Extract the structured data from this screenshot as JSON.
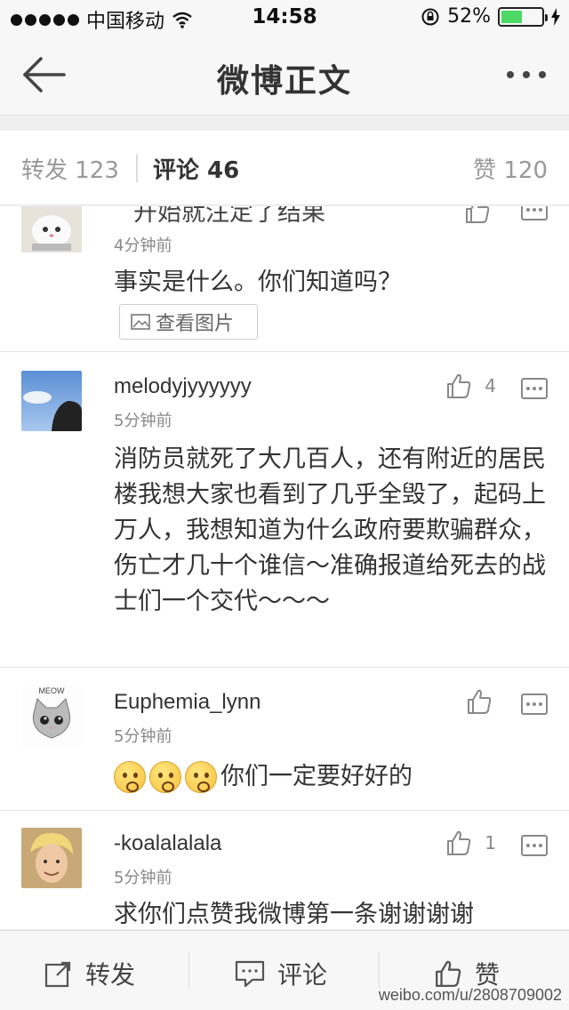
{
  "status_bar": {
    "carrier": "中国移动",
    "time": "14:58",
    "battery_percent": "52%"
  },
  "nav": {
    "title": "微博正文",
    "back_icon": "back-arrow-icon",
    "more_icon": "more-dots-icon"
  },
  "tabs": {
    "repost": "转发 123",
    "comment": "评论 46",
    "like": "赞 120"
  },
  "comments": [
    {
      "name": "",
      "partial_text": "开始就注定了结果",
      "time": "4分钟前",
      "text": "事实是什么。你们知道吗？",
      "view_image_label": "查看图片",
      "likes": ""
    },
    {
      "name": "melodyjyyyyyy",
      "time": "5分钟前",
      "text": "消防员就死了大几百人，还有附近的居民楼我想大家也看到了几乎全毁了，起码上万人，我想知道为什么政府要欺骗群众，伤亡才几十个谁信～准确报道给死去的战士们一个交代～～～",
      "likes": "4"
    },
    {
      "name": "Euphemia_lynn",
      "time": "5分钟前",
      "text": "你们一定要好好的",
      "likes": "",
      "avatar_text": "MEOW"
    },
    {
      "name": "-koalalalala",
      "time": "5分钟前",
      "text": "求你们点赞我微博第一条谢谢谢谢",
      "likes": "1"
    }
  ],
  "toolbar": {
    "repost": "转发",
    "comment": "评论",
    "like": "赞"
  },
  "watermark": "weibo.com/u/2808709002"
}
